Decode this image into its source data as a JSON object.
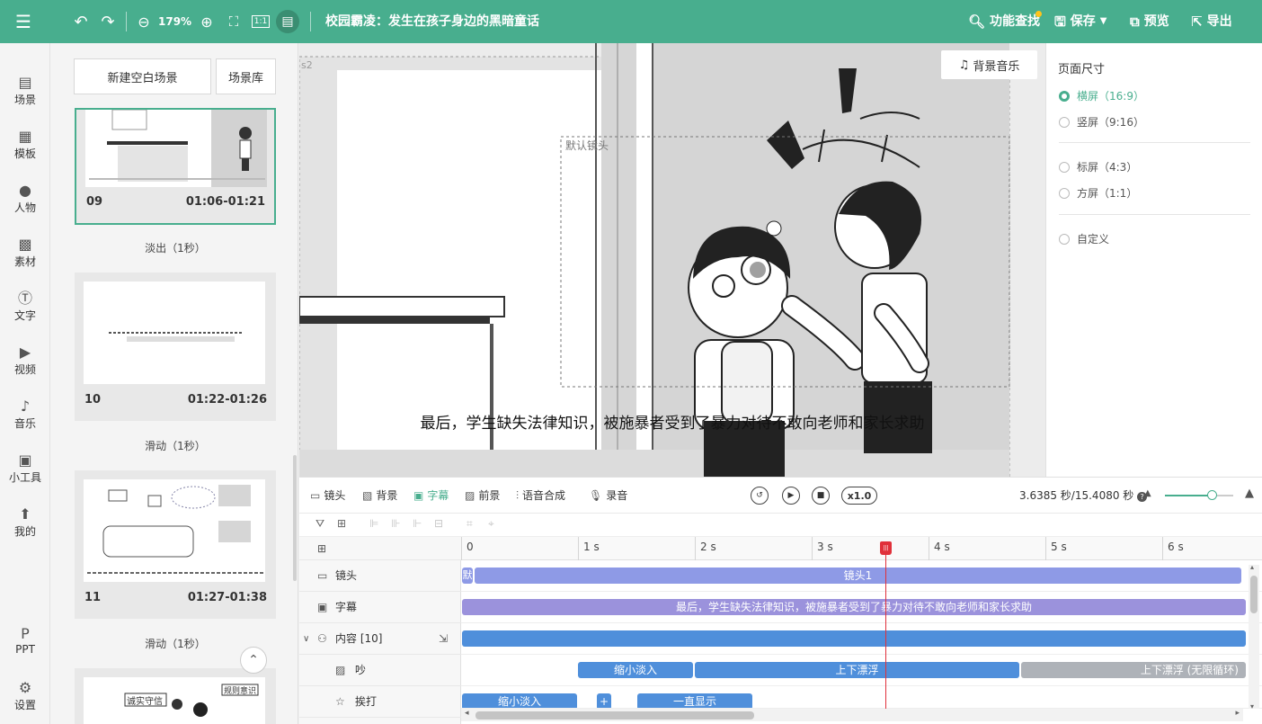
{
  "topbar": {
    "zoom": "179%",
    "title": "校园霸凌：发生在孩子身边的黑暗童话",
    "actions": {
      "find": "功能查找",
      "save": "保存",
      "preview": "预览",
      "export": "导出"
    }
  },
  "rail": {
    "items": [
      {
        "label": "场景",
        "icon": "scene-icon"
      },
      {
        "label": "模板",
        "icon": "template-icon"
      },
      {
        "label": "人物",
        "icon": "person-icon"
      },
      {
        "label": "素材",
        "icon": "material-icon"
      },
      {
        "label": "文字",
        "icon": "text-icon"
      },
      {
        "label": "视频",
        "icon": "video-icon"
      },
      {
        "label": "音乐",
        "icon": "music-icon"
      },
      {
        "label": "小工具",
        "icon": "toolbox-icon"
      },
      {
        "label": "我的",
        "icon": "upload-icon"
      },
      {
        "label": "PPT",
        "icon": "ppt-icon"
      },
      {
        "label": "设置",
        "icon": "gear-icon"
      }
    ]
  },
  "scenes": {
    "new_blank": "新建空白场景",
    "library": "场景库",
    "cards": [
      {
        "num": "09",
        "time": "01:06-01:21",
        "transition": "淡出（1秒）"
      },
      {
        "num": "10",
        "time": "01:22-01:26",
        "transition": "滑动（1秒）"
      },
      {
        "num": "11",
        "time": "01:27-01:38",
        "transition": "滑动（1秒）"
      }
    ],
    "thumb12_labels": [
      "诚实守信",
      "规则意识"
    ]
  },
  "canvas": {
    "bgm": "背景音乐",
    "camera_label": "默认镜头",
    "caption": "最后，学生缺失法律知识，被施暴者受到了暴力对待不敢向老师和家长求助",
    "corner_mark": "s2"
  },
  "props": {
    "title": "页面尺寸",
    "options": [
      {
        "label": "横屏（16:9）",
        "selected": true
      },
      {
        "label": "竖屏（9:16）",
        "selected": false
      },
      {
        "label": "标屏（4:3）",
        "selected": false
      },
      {
        "label": "方屏（1:1）",
        "selected": false
      },
      {
        "label": "自定义",
        "selected": false
      }
    ]
  },
  "timeline": {
    "tabs": [
      "镜头",
      "背景",
      "字幕",
      "前景",
      "语音合成",
      "录音"
    ],
    "active_tab": "字幕",
    "speed": "x1.0",
    "timecode": "3.6385 秒/15.4080 秒",
    "ticks": [
      "0",
      "1 s",
      "2 s",
      "3 s",
      "4 s",
      "5 s",
      "6 s"
    ],
    "tracks": {
      "camera": {
        "label": "镜头",
        "bar_start": "默",
        "bar": "镜头1"
      },
      "subtitle": {
        "label": "字幕",
        "bar": "最后，学生缺失法律知识，被施暴者受到了暴力对待不敢向老师和家长求助"
      },
      "content": {
        "label": "内容 [10]"
      },
      "noise": {
        "label": "吵",
        "bars": [
          "缩小淡入",
          "上下漂浮",
          "上下漂浮 (无限循环)"
        ]
      },
      "hit": {
        "label": "挨打",
        "bars": [
          "缩小淡入",
          "+",
          "一直显示"
        ]
      }
    },
    "playhead_seconds": 3.6385,
    "duration_seconds": 15.408
  }
}
